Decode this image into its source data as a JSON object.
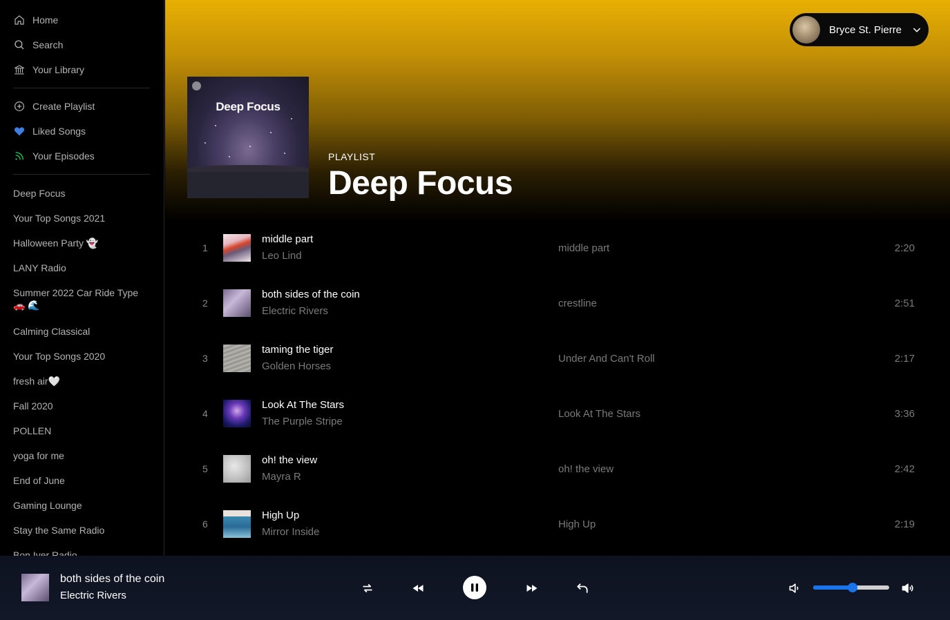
{
  "sidebar": {
    "nav": [
      {
        "label": "Home",
        "icon": "home-icon"
      },
      {
        "label": "Search",
        "icon": "search-icon"
      },
      {
        "label": "Your Library",
        "icon": "library-icon"
      }
    ],
    "actions": [
      {
        "label": "Create Playlist",
        "icon": "plus-circle-icon"
      },
      {
        "label": "Liked Songs",
        "icon": "heart-icon"
      },
      {
        "label": "Your Episodes",
        "icon": "podcast-icon"
      }
    ],
    "playlists": [
      "Deep Focus",
      "Your Top Songs 2021",
      "Halloween Party 👻",
      "LANY Radio",
      "Summer 2022 Car Ride Type 🚗 🌊",
      "Calming Classical",
      "Your Top Songs 2020",
      "fresh air🤍",
      "Fall 2020",
      "POLLEN",
      "yoga for me",
      "End of June",
      "Gaming Lounge",
      "Stay the Same Radio",
      "Bon Iver Radio"
    ]
  },
  "user": {
    "name": "Bryce St. Pierre"
  },
  "playlist": {
    "type": "PLAYLIST",
    "title": "Deep Focus",
    "cover_title": "Deep Focus"
  },
  "tracks": [
    {
      "num": "1",
      "title": "middle part",
      "artist": "Leo Lind",
      "album": "middle part",
      "duration": "2:20"
    },
    {
      "num": "2",
      "title": "both sides of the coin",
      "artist": "Electric Rivers",
      "album": "crestline",
      "duration": "2:51"
    },
    {
      "num": "3",
      "title": "taming the tiger",
      "artist": "Golden Horses",
      "album": "Under And Can't Roll",
      "duration": "2:17"
    },
    {
      "num": "4",
      "title": "Look At The Stars",
      "artist": "The Purple Stripe",
      "album": "Look At The Stars",
      "duration": "3:36"
    },
    {
      "num": "5",
      "title": "oh! the view",
      "artist": "Mayra R",
      "album": "oh! the view",
      "duration": "2:42"
    },
    {
      "num": "6",
      "title": "High Up",
      "artist": "Mirror Inside",
      "album": "High Up",
      "duration": "2:19"
    }
  ],
  "now_playing": {
    "title": "both sides of the coin",
    "artist": "Electric Rivers"
  },
  "controls": {
    "shuffle": "shuffle-icon",
    "previous": "previous-icon",
    "play_pause": "pause-icon",
    "next": "next-icon",
    "repeat": "repeat-icon"
  },
  "volume": {
    "level": 0.52
  },
  "colors": {
    "header_accent": "#e8b004",
    "volume_accent": "#1a73e8",
    "liked_heart": "#3d7fe0",
    "episodes_green": "#1db954"
  }
}
